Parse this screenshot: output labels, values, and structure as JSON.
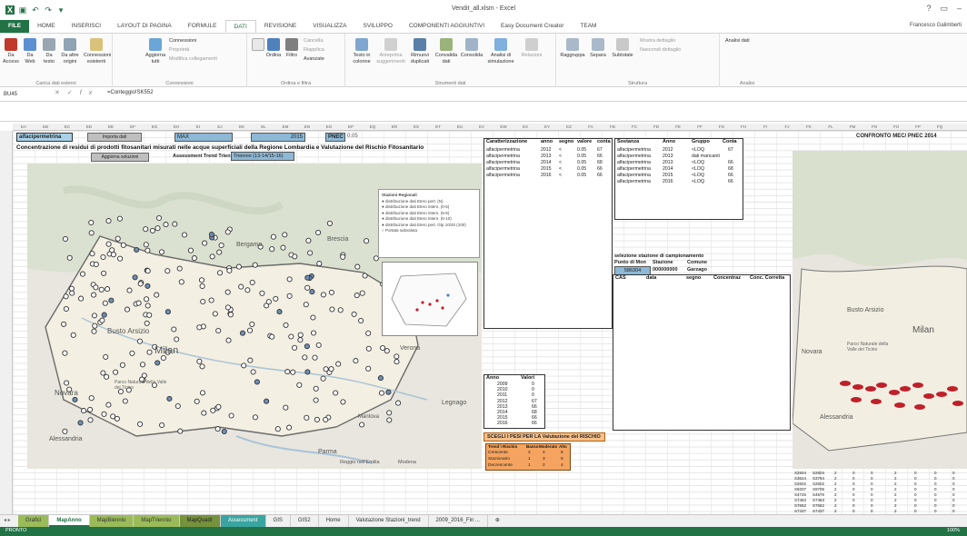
{
  "window": {
    "title": "Vendit_all.xlsm - Excel",
    "user": "Francesco Galimberti"
  },
  "tabs": [
    "FILE",
    "HOME",
    "INSERISCI",
    "LAYOUT DI PAGINA",
    "FORMULE",
    "DATI",
    "REVISIONE",
    "VISUALIZZA",
    "SVILUPPO",
    "COMPONENTI AGGIUNTIVI",
    "Easy Document Creator",
    "TEAM"
  ],
  "ribbon": {
    "groups": [
      {
        "label": "Carica dati esterni",
        "buttons": [
          "Da Access",
          "Da Web",
          "Da testo",
          "Da altre origini",
          "Connessioni esistenti"
        ]
      },
      {
        "label": "Connessioni",
        "buttons": [
          "Aggiorna tutti"
        ],
        "small": [
          "Connessioni",
          "Proprietà",
          "Modifica collegamenti"
        ]
      },
      {
        "label": "Ordina e filtra",
        "buttons": [
          "Ordina",
          "Filtro"
        ],
        "small": [
          "Cancella",
          "Riapplica",
          "Avanzate"
        ]
      },
      {
        "label": "Strumenti dati",
        "buttons": [
          "Testo in colonne",
          "Anteprima suggerimenti",
          "Rimuovi duplicati",
          "Convalida dati",
          "Consolida",
          "Analisi di simulazione",
          "Relazioni"
        ]
      },
      {
        "label": "Struttura",
        "buttons": [
          "Raggruppa",
          "Separa",
          "Subtotale"
        ],
        "small": [
          "Mostra dettaglio",
          "Nascondi dettaglio"
        ]
      },
      {
        "label": "Analisi",
        "small": [
          "Analisi dati"
        ]
      }
    ]
  },
  "formula_bar": {
    "name_box": "BU45",
    "formula": "=Conteggio!SK552"
  },
  "sheet": {
    "selector_substance": "alfacipermetrina",
    "btn_import": "Importa dati",
    "field_max": "MAX",
    "year": "2015",
    "pnec_label": "PNEC",
    "pnec_value": "0.05",
    "title": "Concentrazione di residui di prodotti fitosanitari misurati nelle acque superficiali della Regione Lombardia e Valutazione del Rischio Fitosanitario",
    "btn_update": "Aggiorna soluzioni",
    "assessment_label": "Assessment Trend Triennio",
    "assessment_value": "Triennio (13-14/15-16)",
    "compare_label": "CONFRONTO  MEC/ PNEC 2014"
  },
  "map_labels": [
    "Bergamo",
    "Brescia",
    "Busto Arsizio",
    "Milan",
    "Novara",
    "Parco Naturale della Valle del Ticino",
    "Verona",
    "Mantova",
    "Legnago",
    "Alessandria",
    "Parma",
    "Reggio nell'Emilia",
    "Modena",
    "Piacenza"
  ],
  "map_legend": [
    "Stazioni Regionali",
    "distribuzione dati Etero pert. (N)",
    "distribuzione dati Etero intern. (0-5)",
    "distribuzione dati Etero intern. (5-6)",
    "distribuzione dati Etero intern. (6-10)",
    "distribuzione dati Etero pert. Gtp 10/20 (100)",
    "Portata subvaluta"
  ],
  "table1": {
    "headers": [
      "Caratterizzazione",
      "anno",
      "segno",
      "valore",
      "conta"
    ],
    "rows": [
      [
        "alfacipermetrina",
        "2012",
        "<",
        "0.05",
        "67"
      ],
      [
        "alfacipermetrina",
        "2013",
        "<",
        "0.05",
        "66"
      ],
      [
        "alfacipermetrina",
        "2014",
        "<",
        "0.05",
        "68"
      ],
      [
        "alfacipermetrina",
        "2015",
        "<",
        "0.05",
        "66"
      ],
      [
        "alfacipermetrina",
        "2016",
        "<",
        "0.05",
        "66"
      ]
    ]
  },
  "table2": {
    "headers": [
      "Sostanza",
      "Anno",
      "Gruppo",
      "Conta"
    ],
    "rows": [
      [
        "alfacipermetrina",
        "2012",
        "<LOQ",
        "67"
      ],
      [
        "alfacipermetrina",
        "2013",
        "dati mancanti",
        ""
      ],
      [
        "alfacipermetrina",
        "2013",
        "<LOQ",
        "66"
      ],
      [
        "alfacipermetrina",
        "2014",
        "<LOQ",
        "68"
      ],
      [
        "alfacipermetrina",
        "2015",
        "<LOQ",
        "66"
      ],
      [
        "alfacipermetrina",
        "2016",
        "<LOQ",
        "66"
      ]
    ]
  },
  "station": {
    "title": "selezione stazione di campionamento",
    "headers": [
      "Punto di Mon",
      "Stazione",
      "Comune"
    ],
    "punto": "586304",
    "stazione": "000000000",
    "comune": "Garzago",
    "detail_headers": [
      "CAS",
      "data",
      "segno",
      "Concentraz",
      "Conc. Corretta"
    ]
  },
  "years_table": {
    "headers": [
      "Anno",
      "Valori"
    ],
    "rows": [
      [
        "2009",
        "0"
      ],
      [
        "2010",
        "0"
      ],
      [
        "2011",
        "0"
      ],
      [
        "2012",
        "67"
      ],
      [
        "2013",
        "66"
      ],
      [
        "2014",
        "68"
      ],
      [
        "2015",
        "66"
      ],
      [
        "2016",
        "66"
      ]
    ]
  },
  "weights": {
    "title": "SCEGLI I PESI PER LA Valutazione del RISCHIO",
    "headers": [
      "Trend \\ Rischio",
      "Basso",
      "Moderato",
      "Alto"
    ],
    "rows": [
      [
        "Crescente",
        "2",
        "4",
        "5"
      ],
      [
        "Stazionario",
        "1",
        "3",
        "5"
      ],
      [
        "Decrescente",
        "1",
        "2",
        "4"
      ]
    ]
  },
  "bottom_right_rows": [
    [
      "S2604",
      "S2604",
      "2",
      "0",
      "0",
      "2",
      "0",
      "0",
      "0"
    ],
    [
      "S3624",
      "S3794",
      "2",
      "0",
      "0",
      "2",
      "0",
      "0",
      "0"
    ],
    [
      "S2602",
      "S2602",
      "2",
      "0",
      "0",
      "2",
      "0",
      "0",
      "0"
    ],
    [
      "S9207",
      "S9705",
      "2",
      "0",
      "0",
      "2",
      "0",
      "0",
      "0"
    ],
    [
      "S4726",
      "S4676",
      "2",
      "0",
      "0",
      "2",
      "0",
      "0",
      "0"
    ],
    [
      "S7463",
      "S7463",
      "2",
      "0",
      "0",
      "2",
      "0",
      "0",
      "0"
    ],
    [
      "S7652",
      "S7652",
      "2",
      "0",
      "0",
      "2",
      "0",
      "0",
      "0"
    ],
    [
      "S7437",
      "S7437",
      "2",
      "0",
      "0",
      "2",
      "0",
      "0",
      "0"
    ]
  ],
  "sheet_tabs": [
    "Grafici",
    "MapAnno",
    "MapBiennio",
    "MapTriennio",
    "MapQuadr",
    "Assessment",
    "GIS",
    "GIS2",
    "Home",
    "Valutazione Stazioni_trend",
    "2009_2016_Fin ..."
  ],
  "status": {
    "text": "PRONTO",
    "zoom": "100%"
  },
  "colors": {
    "excel_green": "#217346",
    "selection_blue": "#a9d2e8",
    "orange": "#f4a460",
    "marker_red": "#c0202a"
  }
}
